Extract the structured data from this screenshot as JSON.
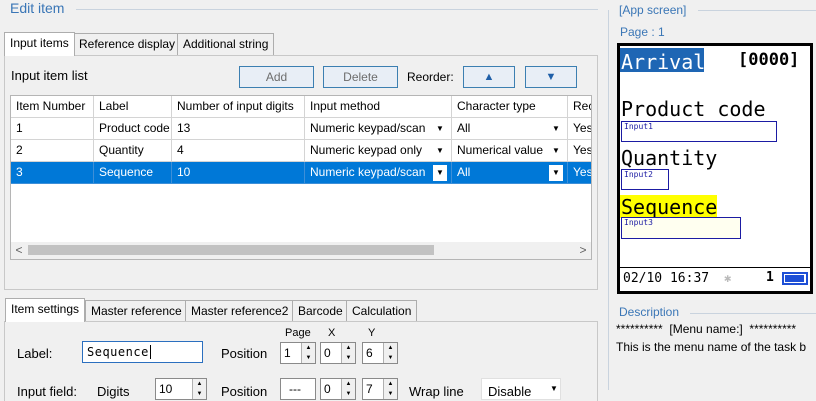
{
  "edit_item": {
    "title": "Edit item",
    "tabs": [
      {
        "label": "Input items",
        "active": true
      },
      {
        "label": "Reference display",
        "active": false
      },
      {
        "label": "Additional string",
        "active": false
      }
    ],
    "list_title": "Input item list",
    "buttons": {
      "add": "Add",
      "delete": "Delete",
      "reorder_label": "Reorder:",
      "up": "▲",
      "down": "▼"
    },
    "columns": [
      "Item Number",
      "Label",
      "Number of input digits",
      "Input method",
      "Character type",
      "Rec"
    ],
    "rows": [
      {
        "num": "1",
        "label": "Product code",
        "digits": "13",
        "method": "Numeric keypad/scan",
        "chartype": "All",
        "rec": "Yes",
        "selected": false
      },
      {
        "num": "2",
        "label": "Quantity",
        "digits": "4",
        "method": "Numeric keypad only",
        "chartype": "Numerical value",
        "rec": "Yes",
        "selected": false
      },
      {
        "num": "3",
        "label": "Sequence",
        "digits": "10",
        "method": "Numeric keypad/scan",
        "chartype": "All",
        "rec": "Yes",
        "selected": true
      }
    ],
    "scroll_left": "<",
    "scroll_right": ">"
  },
  "item_settings": {
    "tabs": [
      "Item settings",
      "Master reference",
      "Master reference2",
      "Barcode",
      "Calculation"
    ],
    "label_caption": "Label:",
    "label_value": "Sequence",
    "position_caption": "Position",
    "page_caption": "Page",
    "x_caption": "X",
    "y_caption": "Y",
    "label_page": "1",
    "label_x": "0",
    "label_y": "6",
    "input_field_caption": "Input field:",
    "digits_caption": "Digits",
    "digits_value": "10",
    "position2_caption": "Position",
    "input_page": "---",
    "input_x": "0",
    "input_y": "7",
    "wrap_caption": "Wrap line",
    "wrap_value": "Disable"
  },
  "app_screen": {
    "title": "[App screen]",
    "page_label": "Page : 1",
    "header_title": "Arrival",
    "header_count": "[0000]",
    "label1": "Product code",
    "input1": "Input1",
    "label2": "Quantity",
    "input2": "Input2",
    "label3": "Sequence",
    "input3": "Input3",
    "status_time": "02/10 16:37",
    "status_num": "1"
  },
  "description": {
    "title": "Description",
    "line1": "**********  [Menu name:]  **********",
    "line2": "This is the menu name of the task b"
  },
  "colors": {
    "accent": "#0078d7",
    "group_title": "#3a76b6",
    "app_header_bg": "#1e66b4",
    "highlight_yellow": "#ffff00"
  }
}
